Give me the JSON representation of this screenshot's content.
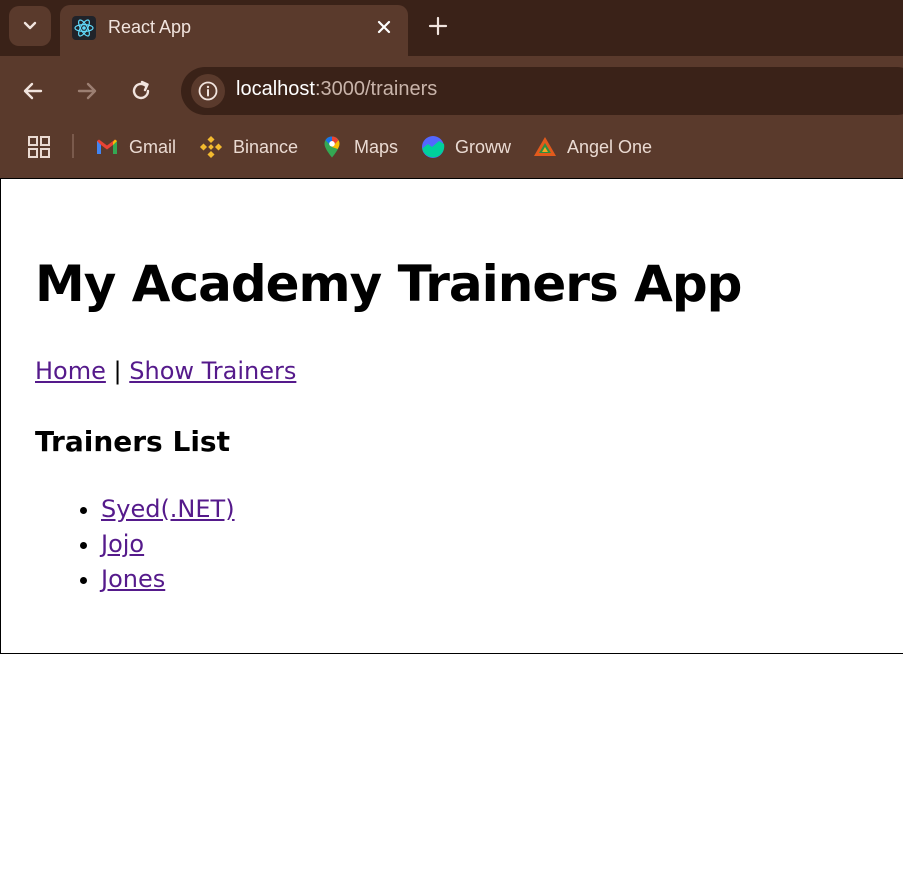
{
  "browser": {
    "tab": {
      "title": "React App",
      "favicon": "react-icon"
    },
    "address": {
      "host": "localhost",
      "path": ":3000/trainers"
    },
    "bookmarks": [
      {
        "label": "Gmail",
        "icon": "gmail-icon"
      },
      {
        "label": "Binance",
        "icon": "binance-icon"
      },
      {
        "label": "Maps",
        "icon": "maps-icon"
      },
      {
        "label": "Groww",
        "icon": "groww-icon"
      },
      {
        "label": "Angel One",
        "icon": "angel-one-icon"
      }
    ],
    "colors": {
      "tabstrip": "#3a2218",
      "toolbar": "#5a3a2c"
    }
  },
  "page": {
    "title": "My Academy Trainers App",
    "nav": {
      "home": "Home",
      "separator": "|",
      "show_trainers": "Show Trainers"
    },
    "section_title": "Trainers List",
    "trainers": [
      "Syed(.NET)",
      "Jojo",
      "Jones"
    ],
    "link_color": "#551a8b"
  }
}
